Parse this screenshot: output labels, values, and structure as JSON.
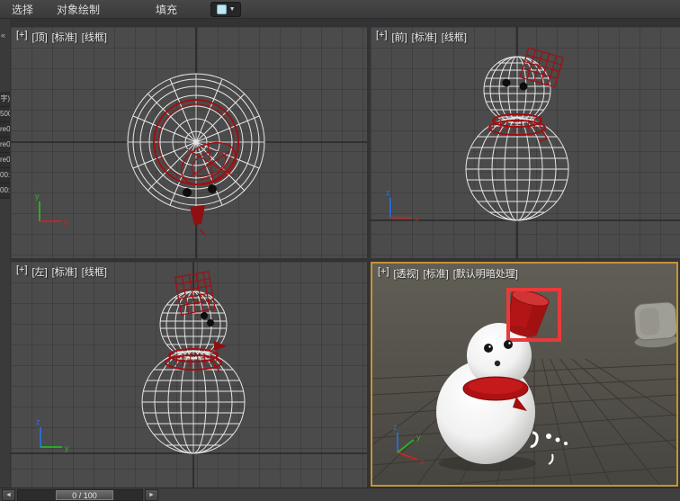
{
  "toolbar": {
    "items": [
      "选择",
      "对象绘制",
      "填充"
    ],
    "caret": "▼"
  },
  "collapse": "«",
  "left_strip": [
    "字)",
    "500",
    "re0",
    "re0",
    "re0",
    "00:",
    "00:"
  ],
  "viewports": {
    "top": {
      "plus": "[+]",
      "view": "[顶]",
      "standard": "[标准]",
      "shading": "[线框]"
    },
    "front": {
      "plus": "[+]",
      "view": "[前]",
      "standard": "[标准]",
      "shading": "[线框]"
    },
    "left": {
      "plus": "[+]",
      "view": "[左]",
      "standard": "[标准]",
      "shading": "[线框]"
    },
    "persp": {
      "plus": "[+]",
      "view": "[透视]",
      "standard": "[标准]",
      "shading": "[默认明暗处理]"
    }
  },
  "axes": {
    "x": "x",
    "y": "y",
    "z": "z"
  },
  "timeline": {
    "prev": "◄",
    "next": "►",
    "frame": "0 / 100"
  },
  "colors": {
    "active_border": "#c79334",
    "wireframe": "#e6e6e6",
    "object_red": "#a00f12",
    "selection_red": "#e83a3a"
  }
}
